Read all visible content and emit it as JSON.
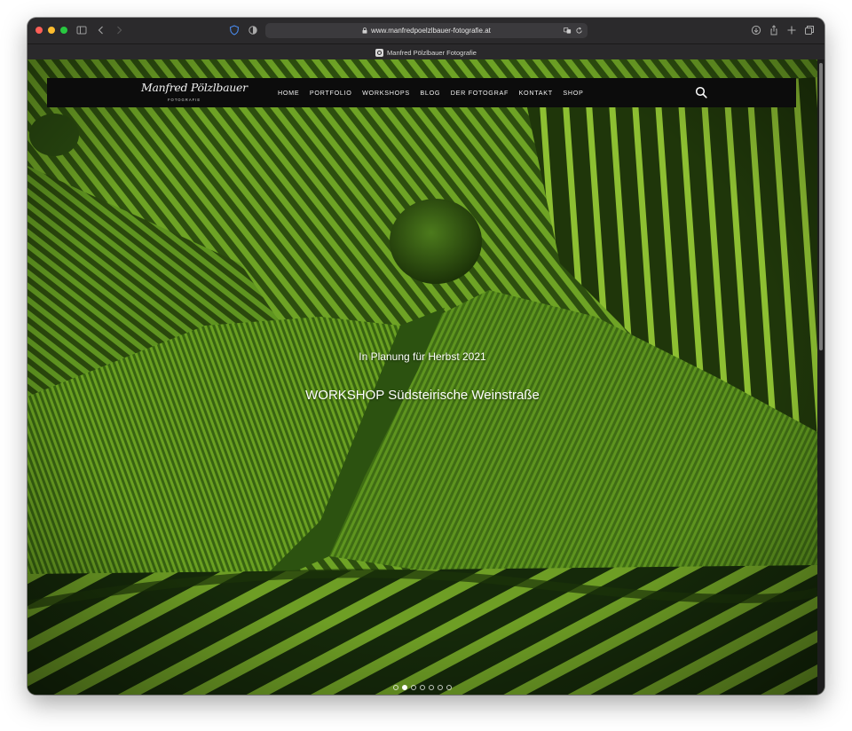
{
  "browser": {
    "url": "www.manfredpoelzlbauer-fotografie.at",
    "tab_title": "Manfred Pölzlbauer Fotografie"
  },
  "site": {
    "logo_text": "Manfred Pölzlbauer",
    "logo_subtext": "FOTOGRAFIE",
    "nav": [
      {
        "label": "HOME"
      },
      {
        "label": "PORTFOLIO"
      },
      {
        "label": "WORKSHOPS"
      },
      {
        "label": "BLOG"
      },
      {
        "label": "DER FOTOGRAF"
      },
      {
        "label": "KONTAKT"
      },
      {
        "label": "SHOP"
      }
    ]
  },
  "hero": {
    "subtitle": "In Planung für Herbst 2021",
    "title": "WORKSHOP Südsteirische Weinstraße",
    "slides_count": 7,
    "active_slide": 2
  },
  "icons": {
    "search": "search-icon",
    "sidebar": "sidebar-icon",
    "back": "chevron-left-icon",
    "forward": "chevron-right-icon",
    "shield": "shield-icon",
    "privacy": "privacy-report-icon",
    "lock": "lock-icon",
    "translate": "translate-icon",
    "reload": "reload-icon",
    "download": "download-icon",
    "share": "share-icon",
    "new_tab": "plus-icon",
    "tabs": "tab-overview-icon"
  },
  "colors": {
    "nav_bg": "#0c0c0c",
    "vineyard_dark": "#1f3a0c",
    "vineyard_light": "#7fb22a"
  }
}
